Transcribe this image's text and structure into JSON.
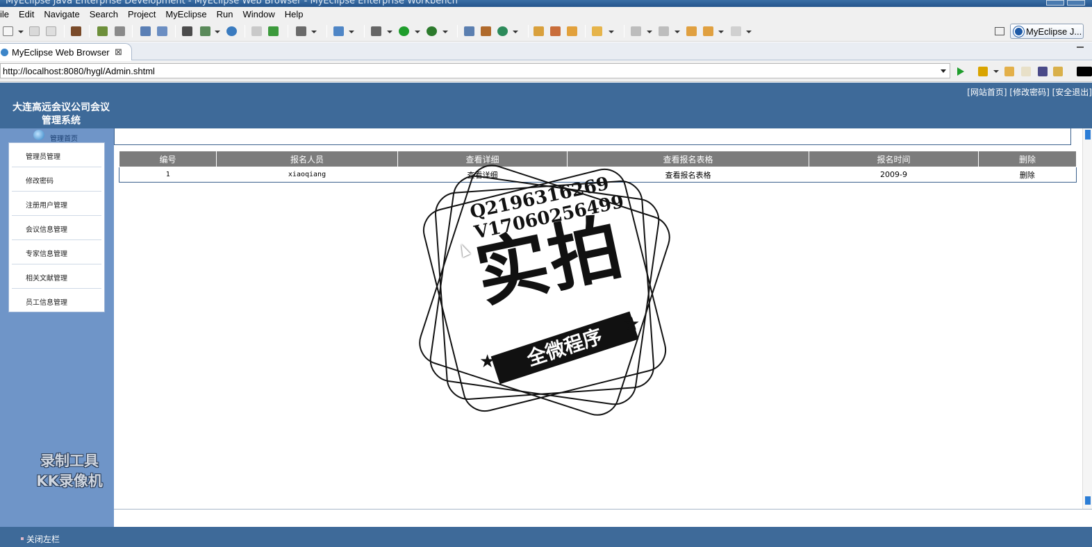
{
  "window": {
    "title": "MyEclipse Java Enterprise Development - MyEclipse Web Browser - MyEclipse Enterprise Workbench"
  },
  "menubar": {
    "items": [
      "ile",
      "Edit",
      "Navigate",
      "Search",
      "Project",
      "MyEclipse",
      "Run",
      "Window",
      "Help"
    ]
  },
  "perspective": {
    "label": "MyEclipse J..."
  },
  "editor_tab": {
    "label": "MyEclipse Web Browser",
    "close": "⊠"
  },
  "address": {
    "url": "http://localhost:8080/hygl/Admin.shtml"
  },
  "app": {
    "top_links": [
      "[网站首页]",
      "[修改密码]",
      "[安全退出]"
    ],
    "system_name_line1": "大连高远会议公司会议",
    "system_name_line2": "管理系统",
    "home_label": "管理首页",
    "menu": [
      "管理员管理",
      "修改密码",
      "注册用户管理",
      "会议信息管理",
      "专家信息管理",
      "相关文献管理",
      "员工信息管理"
    ],
    "footer": "关闭左栏"
  },
  "table": {
    "headers": [
      "编号",
      "报名人员",
      "查看详细",
      "查看报名表格",
      "报名时间",
      "删除"
    ],
    "rows": [
      [
        "1",
        "xiaoqiang",
        "查看详细",
        "查看报名表格",
        "2009-9",
        "删除"
      ]
    ]
  },
  "watermarks": {
    "stamp_line1": "Q2196316269",
    "stamp_line2": "V17060256499",
    "stamp_big": "实拍",
    "stamp_band": "全微程序",
    "recorder_line1": "录制工具",
    "recorder_line2": "KK录像机"
  },
  "colors": {
    "app_header": "#3e6a99",
    "sidebar": "#6f95c8",
    "table_header": "#7c7c7c"
  }
}
